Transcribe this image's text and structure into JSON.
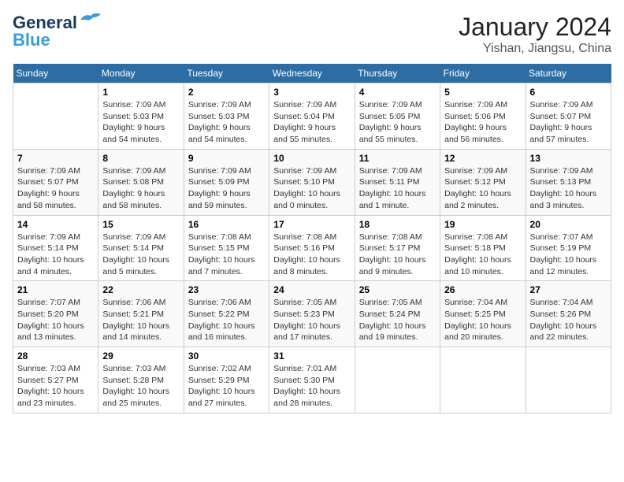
{
  "header": {
    "logo_general": "General",
    "logo_blue": "Blue",
    "month_title": "January 2024",
    "location": "Yishan, Jiangsu, China"
  },
  "weekdays": [
    "Sunday",
    "Monday",
    "Tuesday",
    "Wednesday",
    "Thursday",
    "Friday",
    "Saturday"
  ],
  "weeks": [
    [
      {
        "day": "",
        "sunrise": "",
        "sunset": "",
        "daylight": ""
      },
      {
        "day": "1",
        "sunrise": "Sunrise: 7:09 AM",
        "sunset": "Sunset: 5:03 PM",
        "daylight": "Daylight: 9 hours and 54 minutes."
      },
      {
        "day": "2",
        "sunrise": "Sunrise: 7:09 AM",
        "sunset": "Sunset: 5:03 PM",
        "daylight": "Daylight: 9 hours and 54 minutes."
      },
      {
        "day": "3",
        "sunrise": "Sunrise: 7:09 AM",
        "sunset": "Sunset: 5:04 PM",
        "daylight": "Daylight: 9 hours and 55 minutes."
      },
      {
        "day": "4",
        "sunrise": "Sunrise: 7:09 AM",
        "sunset": "Sunset: 5:05 PM",
        "daylight": "Daylight: 9 hours and 55 minutes."
      },
      {
        "day": "5",
        "sunrise": "Sunrise: 7:09 AM",
        "sunset": "Sunset: 5:06 PM",
        "daylight": "Daylight: 9 hours and 56 minutes."
      },
      {
        "day": "6",
        "sunrise": "Sunrise: 7:09 AM",
        "sunset": "Sunset: 5:07 PM",
        "daylight": "Daylight: 9 hours and 57 minutes."
      }
    ],
    [
      {
        "day": "7",
        "sunrise": "Sunrise: 7:09 AM",
        "sunset": "Sunset: 5:07 PM",
        "daylight": "Daylight: 9 hours and 58 minutes."
      },
      {
        "day": "8",
        "sunrise": "Sunrise: 7:09 AM",
        "sunset": "Sunset: 5:08 PM",
        "daylight": "Daylight: 9 hours and 58 minutes."
      },
      {
        "day": "9",
        "sunrise": "Sunrise: 7:09 AM",
        "sunset": "Sunset: 5:09 PM",
        "daylight": "Daylight: 9 hours and 59 minutes."
      },
      {
        "day": "10",
        "sunrise": "Sunrise: 7:09 AM",
        "sunset": "Sunset: 5:10 PM",
        "daylight": "Daylight: 10 hours and 0 minutes."
      },
      {
        "day": "11",
        "sunrise": "Sunrise: 7:09 AM",
        "sunset": "Sunset: 5:11 PM",
        "daylight": "Daylight: 10 hours and 1 minute."
      },
      {
        "day": "12",
        "sunrise": "Sunrise: 7:09 AM",
        "sunset": "Sunset: 5:12 PM",
        "daylight": "Daylight: 10 hours and 2 minutes."
      },
      {
        "day": "13",
        "sunrise": "Sunrise: 7:09 AM",
        "sunset": "Sunset: 5:13 PM",
        "daylight": "Daylight: 10 hours and 3 minutes."
      }
    ],
    [
      {
        "day": "14",
        "sunrise": "Sunrise: 7:09 AM",
        "sunset": "Sunset: 5:14 PM",
        "daylight": "Daylight: 10 hours and 4 minutes."
      },
      {
        "day": "15",
        "sunrise": "Sunrise: 7:09 AM",
        "sunset": "Sunset: 5:14 PM",
        "daylight": "Daylight: 10 hours and 5 minutes."
      },
      {
        "day": "16",
        "sunrise": "Sunrise: 7:08 AM",
        "sunset": "Sunset: 5:15 PM",
        "daylight": "Daylight: 10 hours and 7 minutes."
      },
      {
        "day": "17",
        "sunrise": "Sunrise: 7:08 AM",
        "sunset": "Sunset: 5:16 PM",
        "daylight": "Daylight: 10 hours and 8 minutes."
      },
      {
        "day": "18",
        "sunrise": "Sunrise: 7:08 AM",
        "sunset": "Sunset: 5:17 PM",
        "daylight": "Daylight: 10 hours and 9 minutes."
      },
      {
        "day": "19",
        "sunrise": "Sunrise: 7:08 AM",
        "sunset": "Sunset: 5:18 PM",
        "daylight": "Daylight: 10 hours and 10 minutes."
      },
      {
        "day": "20",
        "sunrise": "Sunrise: 7:07 AM",
        "sunset": "Sunset: 5:19 PM",
        "daylight": "Daylight: 10 hours and 12 minutes."
      }
    ],
    [
      {
        "day": "21",
        "sunrise": "Sunrise: 7:07 AM",
        "sunset": "Sunset: 5:20 PM",
        "daylight": "Daylight: 10 hours and 13 minutes."
      },
      {
        "day": "22",
        "sunrise": "Sunrise: 7:06 AM",
        "sunset": "Sunset: 5:21 PM",
        "daylight": "Daylight: 10 hours and 14 minutes."
      },
      {
        "day": "23",
        "sunrise": "Sunrise: 7:06 AM",
        "sunset": "Sunset: 5:22 PM",
        "daylight": "Daylight: 10 hours and 16 minutes."
      },
      {
        "day": "24",
        "sunrise": "Sunrise: 7:05 AM",
        "sunset": "Sunset: 5:23 PM",
        "daylight": "Daylight: 10 hours and 17 minutes."
      },
      {
        "day": "25",
        "sunrise": "Sunrise: 7:05 AM",
        "sunset": "Sunset: 5:24 PM",
        "daylight": "Daylight: 10 hours and 19 minutes."
      },
      {
        "day": "26",
        "sunrise": "Sunrise: 7:04 AM",
        "sunset": "Sunset: 5:25 PM",
        "daylight": "Daylight: 10 hours and 20 minutes."
      },
      {
        "day": "27",
        "sunrise": "Sunrise: 7:04 AM",
        "sunset": "Sunset: 5:26 PM",
        "daylight": "Daylight: 10 hours and 22 minutes."
      }
    ],
    [
      {
        "day": "28",
        "sunrise": "Sunrise: 7:03 AM",
        "sunset": "Sunset: 5:27 PM",
        "daylight": "Daylight: 10 hours and 23 minutes."
      },
      {
        "day": "29",
        "sunrise": "Sunrise: 7:03 AM",
        "sunset": "Sunset: 5:28 PM",
        "daylight": "Daylight: 10 hours and 25 minutes."
      },
      {
        "day": "30",
        "sunrise": "Sunrise: 7:02 AM",
        "sunset": "Sunset: 5:29 PM",
        "daylight": "Daylight: 10 hours and 27 minutes."
      },
      {
        "day": "31",
        "sunrise": "Sunrise: 7:01 AM",
        "sunset": "Sunset: 5:30 PM",
        "daylight": "Daylight: 10 hours and 28 minutes."
      },
      {
        "day": "",
        "sunrise": "",
        "sunset": "",
        "daylight": ""
      },
      {
        "day": "",
        "sunrise": "",
        "sunset": "",
        "daylight": ""
      },
      {
        "day": "",
        "sunrise": "",
        "sunset": "",
        "daylight": ""
      }
    ]
  ]
}
